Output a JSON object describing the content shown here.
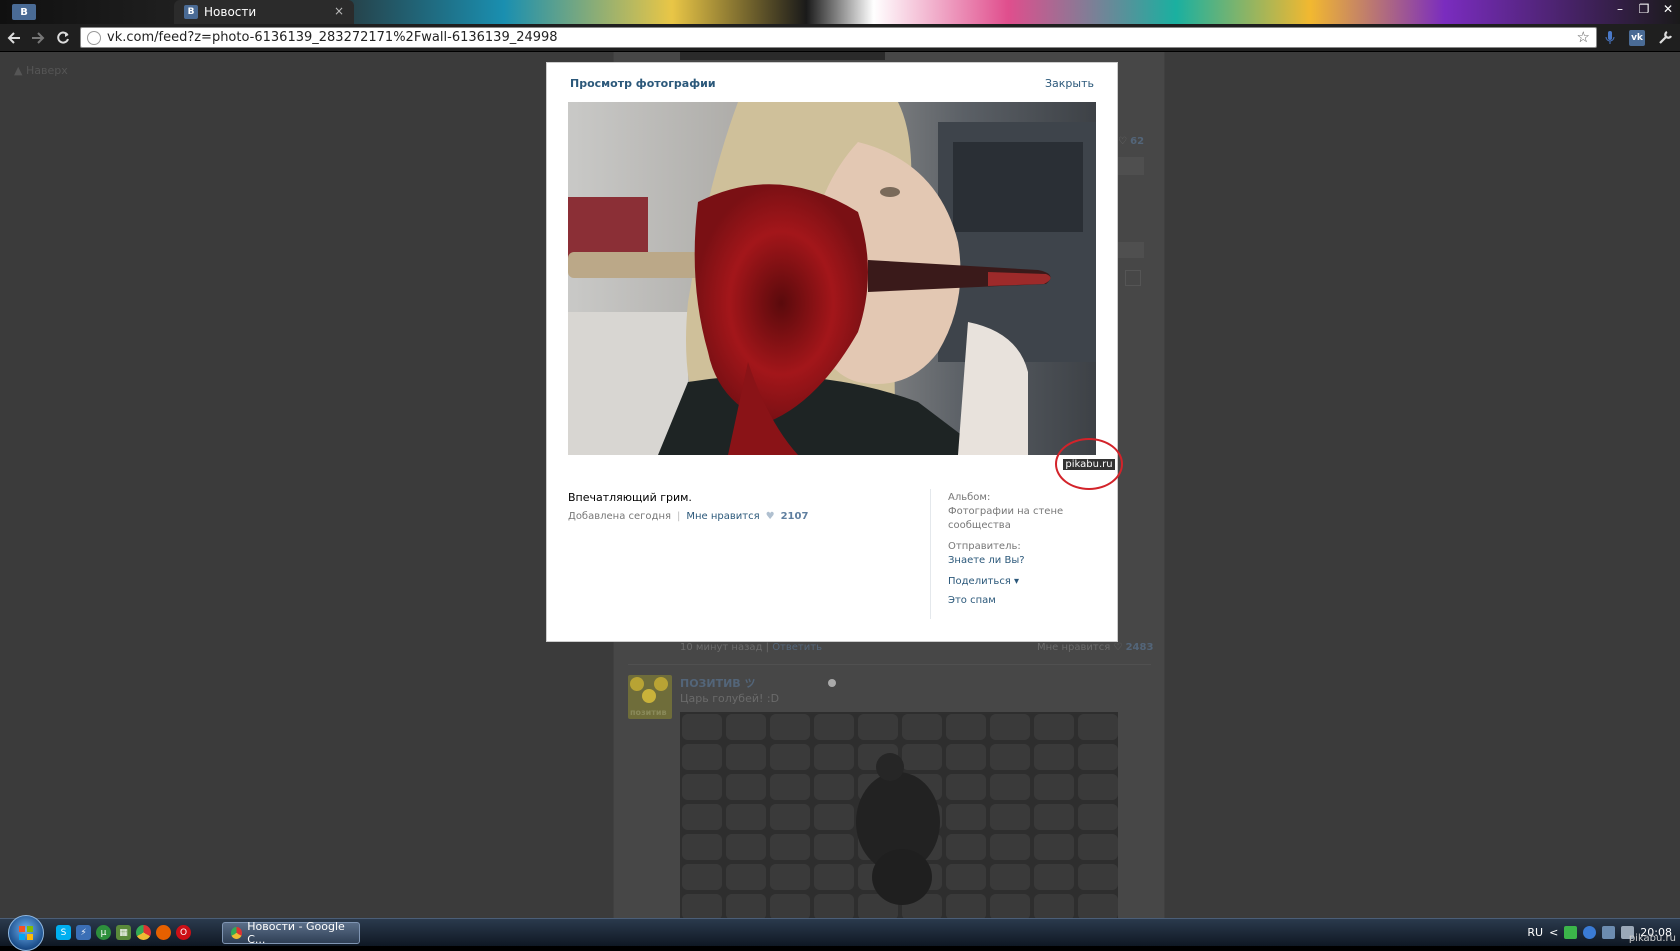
{
  "browser": {
    "small_tab_label": "В",
    "tab_title": "Новости",
    "tab_favicon": "В",
    "tab_close": "×",
    "url": "vk.com/feed?z=photo-6136139_283272171%2Fwall-6136139_24998",
    "window_controls": [
      "–",
      "❐",
      "✕"
    ],
    "extension_vk": "vk"
  },
  "page": {
    "back_up_label": "▲ Наверх",
    "prev_post_meta": {
      "time": "10 минут назад",
      "sep": "|",
      "reply": "Ответить"
    },
    "prev_post_likes": {
      "label": "Мне нравится",
      "count": "2483"
    },
    "side_likes_count": "62",
    "post": {
      "author": "ПОЗИТИВ ツ",
      "text": "Царь голубей! :D",
      "avatar_text": "позитив"
    }
  },
  "modal": {
    "title": "Просмотр фотографии",
    "close": "Закрыть",
    "watermark": "pikabu.ru",
    "caption": "Впечатляющий грим.",
    "added": "Добавлена сегодня",
    "sep": "|",
    "like_label": "Мне нравится",
    "like_count": "2107",
    "album_label": "Альбом:",
    "album_value": "Фотографии на стене сообщества",
    "sender_label": "Отправитель:",
    "sender_value": "Знаете ли Вы?",
    "share": "Поделиться ▾",
    "spam": "Это спам"
  },
  "taskbar": {
    "task_button": "Новости - Google C...",
    "lang": "RU",
    "clock": "20:08",
    "arrow": "<"
  },
  "footer_watermark": "pikabu.ru",
  "colors": {
    "vk_link": "#2b587a",
    "annotation_red": "#d3232a",
    "vk_blue": "#4a6b95"
  }
}
